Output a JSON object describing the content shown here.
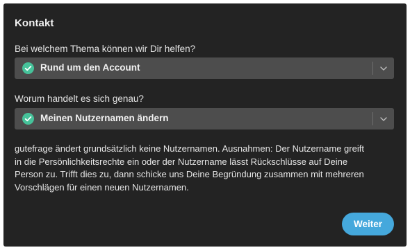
{
  "dialog": {
    "title": "Kontakt",
    "topic": {
      "question": "Bei welchem Thema können wir Dir helfen?",
      "selected": "Rund um den Account"
    },
    "detail": {
      "question": "Worum handelt es sich genau?",
      "selected": "Meinen Nutzernamen ändern"
    },
    "info_lines": [
      "gutefrage ändert grundsätzlich keine Nutzernamen. Ausnahmen: Der Nutzername greift",
      "in die Persönlichkeitsrechte ein oder der Nutzername lässt Rückschlüsse auf Deine",
      "Person zu. Trifft dies zu, dann schicke uns Deine Begründung zusammen mit mehreren",
      "Vorschlägen für einen neuen Nutzernamen."
    ],
    "next_label": "Weiter"
  },
  "icons": {
    "check": "check-circle-icon",
    "chevron": "chevron-down-icon"
  },
  "colors": {
    "dialog_bg": "#232323",
    "select_bg": "#4d4d4d",
    "check_green": "#46c29a",
    "accent_blue": "#45a8dc"
  }
}
